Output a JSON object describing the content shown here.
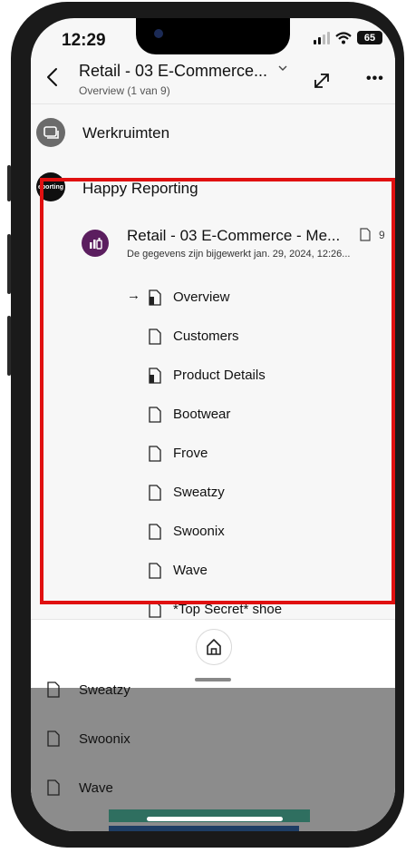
{
  "status_bar": {
    "time": "12:29",
    "battery": "65"
  },
  "header": {
    "title": "Retail - 03 E-Commerce...",
    "subtitle": "Overview (1 van 9)"
  },
  "nav": {
    "workspaces_label": "Werkruimten",
    "workspace_name": "Happy Reporting",
    "workspace_avatar_text": "eporting"
  },
  "report": {
    "title": "Retail - 03 E-Commerce - Me...",
    "subtitle": "De gegevens zijn bijgewerkt jan. 29, 2024, 12:26...",
    "page_count": "9"
  },
  "pages": [
    {
      "label": "Overview",
      "current": true,
      "icon": "page-filled-icon"
    },
    {
      "label": "Customers",
      "current": false,
      "icon": "page-icon"
    },
    {
      "label": "Product Details",
      "current": false,
      "icon": "page-filled-icon"
    },
    {
      "label": "Bootwear",
      "current": false,
      "icon": "page-icon"
    },
    {
      "label": "Frove",
      "current": false,
      "icon": "page-icon"
    },
    {
      "label": "Sweatzy",
      "current": false,
      "icon": "page-icon"
    },
    {
      "label": "Swoonix",
      "current": false,
      "icon": "page-icon"
    },
    {
      "label": "Wave",
      "current": false,
      "icon": "page-icon"
    },
    {
      "label": "*Top Secret* shoe",
      "current": false,
      "icon": "page-icon"
    }
  ],
  "current_marker": "→",
  "background_list": [
    {
      "label": "Sweatzy"
    },
    {
      "label": "Swoonix"
    },
    {
      "label": "Wave"
    }
  ],
  "colors": {
    "highlight": "#e01010",
    "report_icon": "#5b1e5f",
    "background_overlay": "#8c8c8c"
  }
}
